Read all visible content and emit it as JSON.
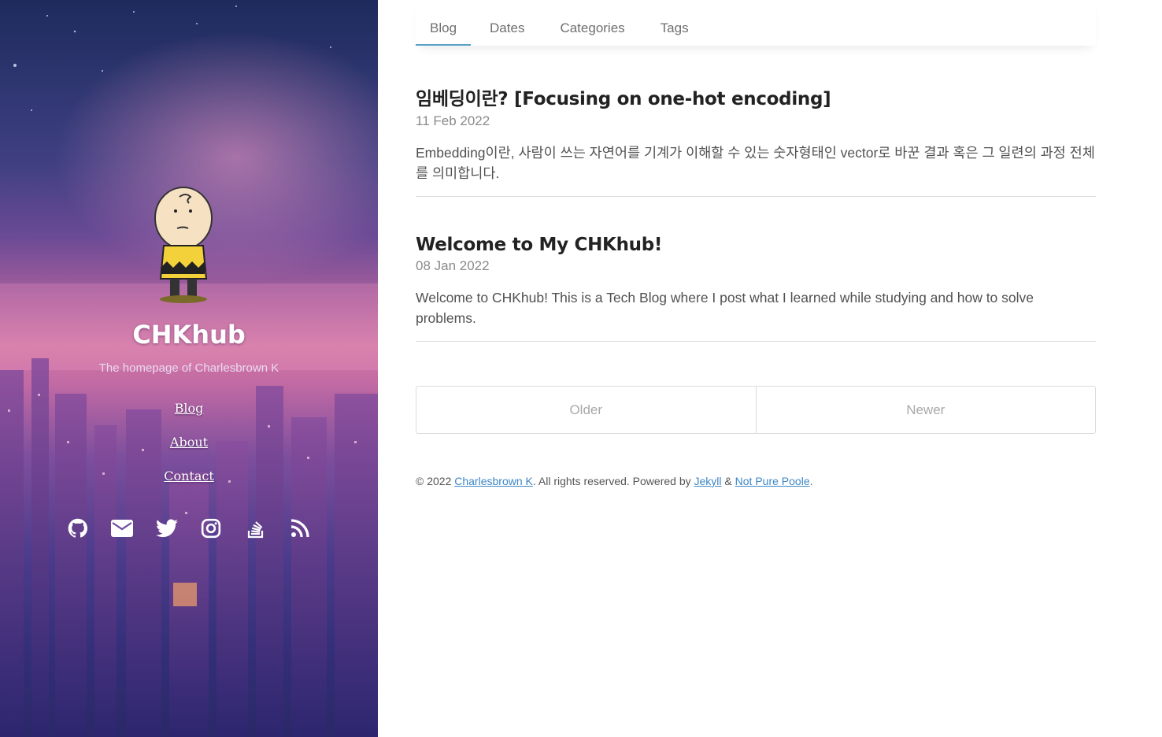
{
  "sidebar": {
    "title": "CHKhub",
    "description": "The homepage of Charlesbrown K",
    "nav": [
      "Blog",
      "About",
      "Contact"
    ],
    "socials": [
      "github-icon",
      "email-icon",
      "twitter-icon",
      "instagram-icon",
      "stackoverflow-icon",
      "rss-icon"
    ]
  },
  "tabs": [
    {
      "label": "Blog",
      "active": true
    },
    {
      "label": "Dates",
      "active": false
    },
    {
      "label": "Categories",
      "active": false
    },
    {
      "label": "Tags",
      "active": false
    }
  ],
  "posts": [
    {
      "title": "임베딩이란? [Focusing on one-hot encoding]",
      "date": "11 Feb 2022",
      "excerpt": "Embedding이란, 사람이 쓰는 자연어를 기계가 이해할 수 있는 숫자형태인 vector로 바꾼 결과 혹은 그 일련의 과정 전체를 의미합니다."
    },
    {
      "title": "Welcome to My CHKhub!",
      "date": "08 Jan 2022",
      "excerpt": "Welcome to CHKhub! This is a Tech Blog where I post what I learned while studying and how to solve problems."
    }
  ],
  "pagination": {
    "older": "Older",
    "newer": "Newer"
  },
  "footer": {
    "prefix": "© 2022 ",
    "author": "Charlesbrown K",
    "middle": ". All rights reserved. Powered by ",
    "jekyll": "Jekyll",
    "amp": " & ",
    "theme": "Not Pure Poole",
    "suffix": "."
  },
  "colors": {
    "accent": "#5aa0c6",
    "link": "#3d86c6"
  }
}
